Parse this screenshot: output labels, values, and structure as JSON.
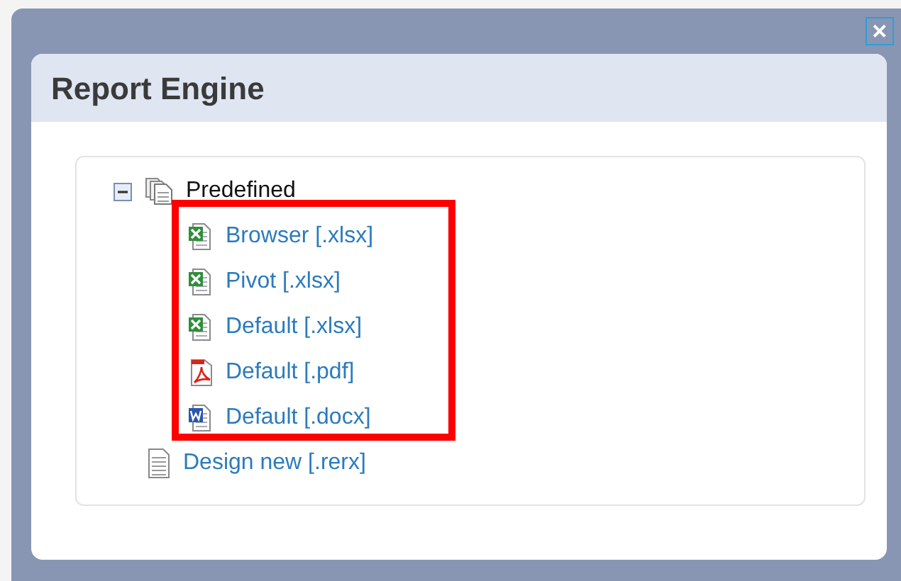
{
  "dialog": {
    "title": "Report Engine",
    "close_label": "✕"
  },
  "tree": [
    {
      "label": "Predefined",
      "kind": "folder",
      "expanded": true,
      "children": [
        {
          "label": "Browser [.xlsx]",
          "kind": "xlsx"
        },
        {
          "label": "Pivot [.xlsx]",
          "kind": "xlsx"
        },
        {
          "label": "Default [.xlsx]",
          "kind": "xlsx"
        },
        {
          "label": "Default [.pdf]",
          "kind": "pdf"
        },
        {
          "label": "Default [.docx]",
          "kind": "docx"
        }
      ]
    },
    {
      "label": "Design new [.rerx]",
      "kind": "rerx"
    }
  ]
}
